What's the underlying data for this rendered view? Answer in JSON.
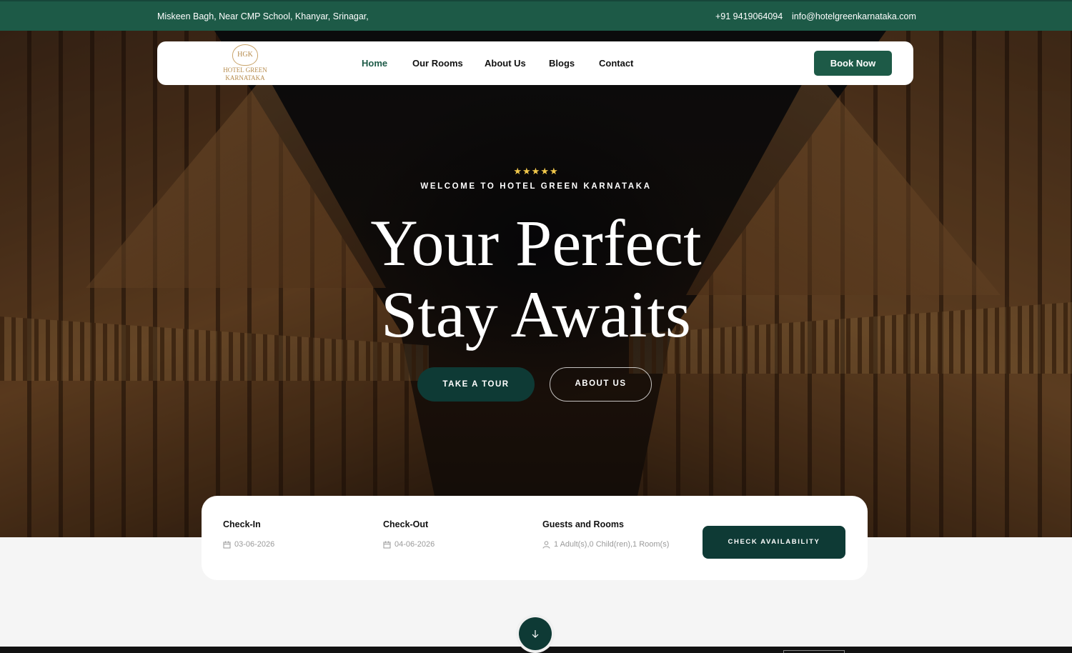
{
  "topbar": {
    "address": "Miskeen Bagh, Near CMP School, Khanyar, Srinagar,",
    "phone": "+91 9419064094",
    "email": "info@hotelgreenkarnataka.com"
  },
  "brand": {
    "logo_monogram": "HGK",
    "logo_line1": "HOTEL GREEN",
    "logo_line2": "KARNATAKA",
    "primary_color": "#1d5a47",
    "dark_accent": "#0e3a35",
    "star_color": "#f2c84b"
  },
  "nav": {
    "items": [
      {
        "label": "Home",
        "active": true
      },
      {
        "label": "Our Rooms",
        "active": false
      },
      {
        "label": "About Us",
        "active": false
      },
      {
        "label": "Blogs",
        "active": false
      },
      {
        "label": "Contact",
        "active": false
      }
    ],
    "cta_label": "Book Now"
  },
  "hero": {
    "rating_stars": 5,
    "stars_text": "★★★★★",
    "welcome": "WELCOME TO HOTEL GREEN KARNATAKA",
    "headline_line1": "Your Perfect",
    "headline_line2": "Stay Awaits",
    "primary_button": "TAKE A TOUR",
    "secondary_button": "ABOUT US"
  },
  "booking": {
    "checkin_label": "Check-In",
    "checkin_value": "03-06-2026",
    "checkout_label": "Check-Out",
    "checkout_value": "04-06-2026",
    "guests_label": "Guests and Rooms",
    "guests_value": "1 Adult(s),0 Child(ren),1 Room(s)",
    "button_label": "CHECK AVAILABILITY",
    "icons": [
      "calendar-icon",
      "calendar-icon",
      "user-icon"
    ]
  },
  "scroll": {
    "icon": "arrow-down-icon"
  }
}
